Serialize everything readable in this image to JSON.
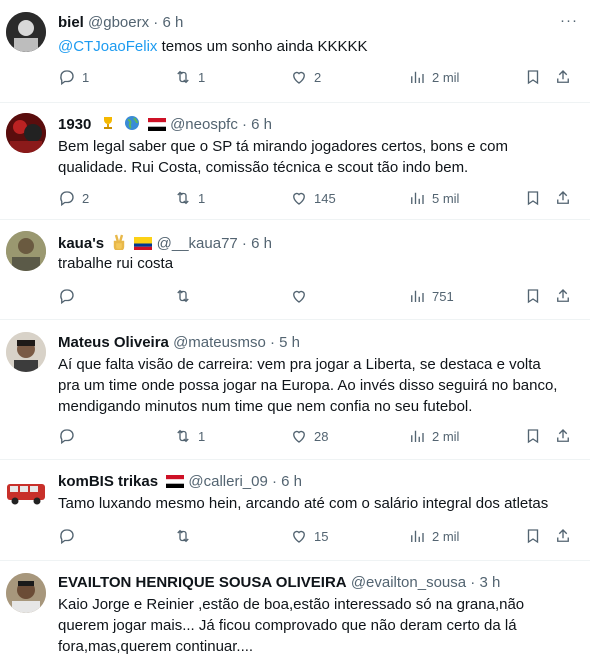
{
  "tweets": [
    {
      "name": "biel",
      "handle": "@gboerx",
      "time": "6 h",
      "mention": "@CTJoaoFelix",
      "text": " temos um sonho ainda KKKKK",
      "lines": [],
      "reply": "1",
      "retweet": "1",
      "like": "2",
      "views": "2 mil"
    },
    {
      "name": "1930",
      "handle": "@neospfc",
      "time": "6 h",
      "lines": [
        "Bem legal saber que o SP tá mirando jogadores certos, bons e com",
        "qualidade. Rui Costa, comissão técnica e scout tão indo bem."
      ],
      "reply": "2",
      "retweet": "1",
      "like": "145",
      "views": "5 mil"
    },
    {
      "name": "kaua's",
      "handle": "@__kaua77",
      "time": "6 h",
      "lines": [
        "trabalhe rui costa"
      ],
      "reply": "",
      "retweet": "",
      "like": "",
      "views": "751"
    },
    {
      "name": "Mateus Oliveira",
      "handle": "@mateusmso",
      "time": "5 h",
      "lines": [
        "Aí que falta visão de carreira: vem pra jogar a Liberta, se destaca e volta",
        "pra um time onde possa jogar na Europa. Ao invés disso seguirá no banco,",
        "mendigando minutos num time que nem confia no seu futebol."
      ],
      "reply": "",
      "retweet": "1",
      "like": "28",
      "views": "2 mil"
    },
    {
      "name": "komBIS trikas",
      "handle": "@calleri_09",
      "time": "6 h",
      "lines": [
        "Tamo luxando mesmo hein, arcando até com o salário integral dos atletas"
      ],
      "reply": "",
      "retweet": "",
      "like": "15",
      "views": "2 mil"
    },
    {
      "name": "EVAILTON HENRIQUE SOUSA OLIVEIRA",
      "handle": "@evailton_sousa",
      "time": "3 h",
      "lines": [
        "Kaio Jorge e Reinier ,estão de boa,estão interessado só na grana,não",
        "querem jogar mais... Já ficou comprovado que não deram certo da lá",
        "fora,mas,querem continuar...."
      ]
    }
  ],
  "dot": "·",
  "more": "···",
  "colors": {
    "accent": "#1d9bf0",
    "muted": "#536471",
    "text": "#0f1419"
  }
}
